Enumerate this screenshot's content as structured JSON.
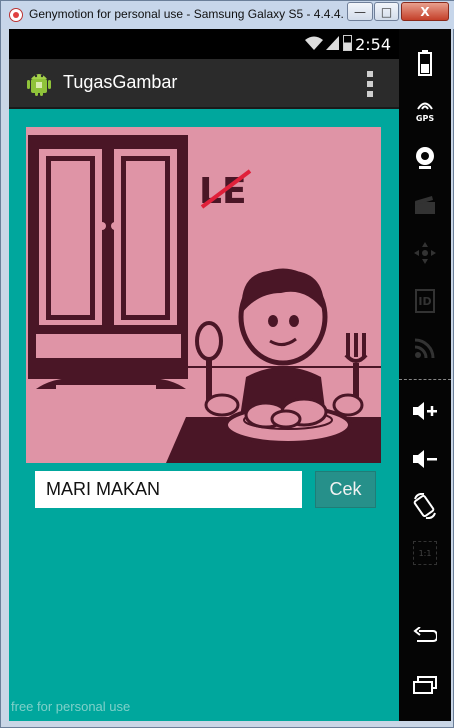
{
  "window": {
    "title": "Genymotion for personal use - Samsung Galaxy S5 - 4.4.4...",
    "minimize": "—",
    "maximize": "□",
    "close": "X"
  },
  "statusbar": {
    "time": "2:54"
  },
  "app": {
    "title": "TugasGambar"
  },
  "picture": {
    "sign_text": "LE"
  },
  "form": {
    "answer_value": "MARI MAKAN",
    "check_label": "Cek"
  },
  "watermark": "free for personal use",
  "sidepanel": {
    "gps_label": "GPS",
    "id_label": "ID",
    "scale_label": "1:1"
  },
  "colors": {
    "background": "#00a79d",
    "actionbar": "#2b2b2b",
    "button": "#26908a",
    "picture_bg": "#df94a6",
    "picture_ink": "#4a1626"
  }
}
